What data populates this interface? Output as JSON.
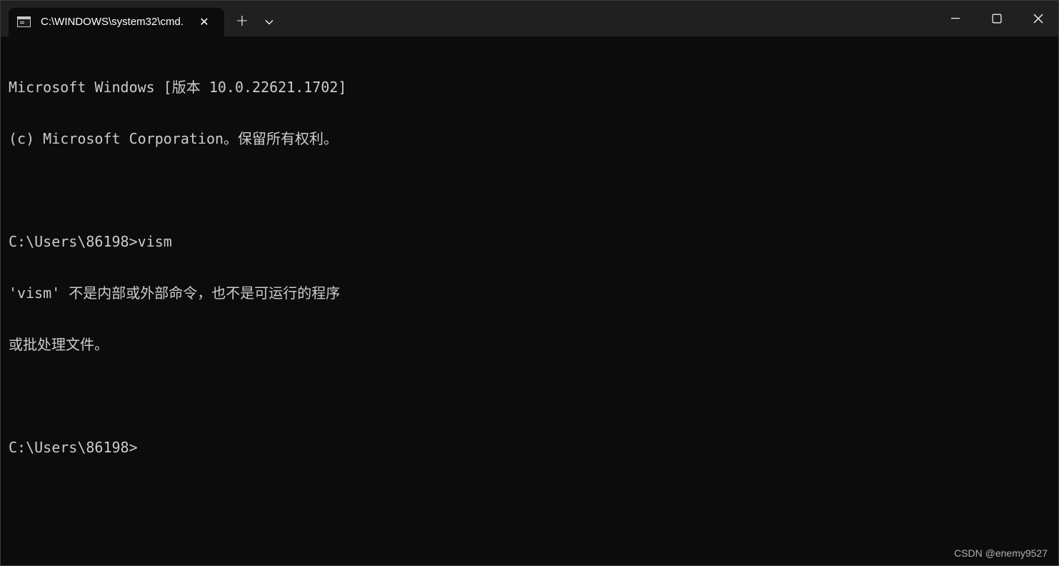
{
  "titlebar": {
    "tab": {
      "title": "C:\\WINDOWS\\system32\\cmd.",
      "icon": "console-icon",
      "close_icon": "close-icon"
    },
    "new_tab_icon": "plus-icon",
    "new_tab_glyph": "+",
    "dropdown_icon": "chevron-down-icon",
    "window_controls": {
      "minimize_icon": "minimize-icon",
      "maximize_icon": "maximize-icon",
      "close_icon": "close-icon"
    }
  },
  "console": {
    "lines": [
      "Microsoft Windows [版本 10.0.22621.1702]",
      "(c) Microsoft Corporation。保留所有权利。",
      "",
      "C:\\Users\\86198>vism",
      "'vism' 不是内部或外部命令，也不是可运行的程序",
      "或批处理文件。",
      "",
      "C:\\Users\\86198>"
    ]
  },
  "watermark": "CSDN @enemy9527",
  "colors": {
    "titlebar_bg": "#202020",
    "console_bg": "#0c0c0c",
    "console_text": "#cccccc"
  }
}
